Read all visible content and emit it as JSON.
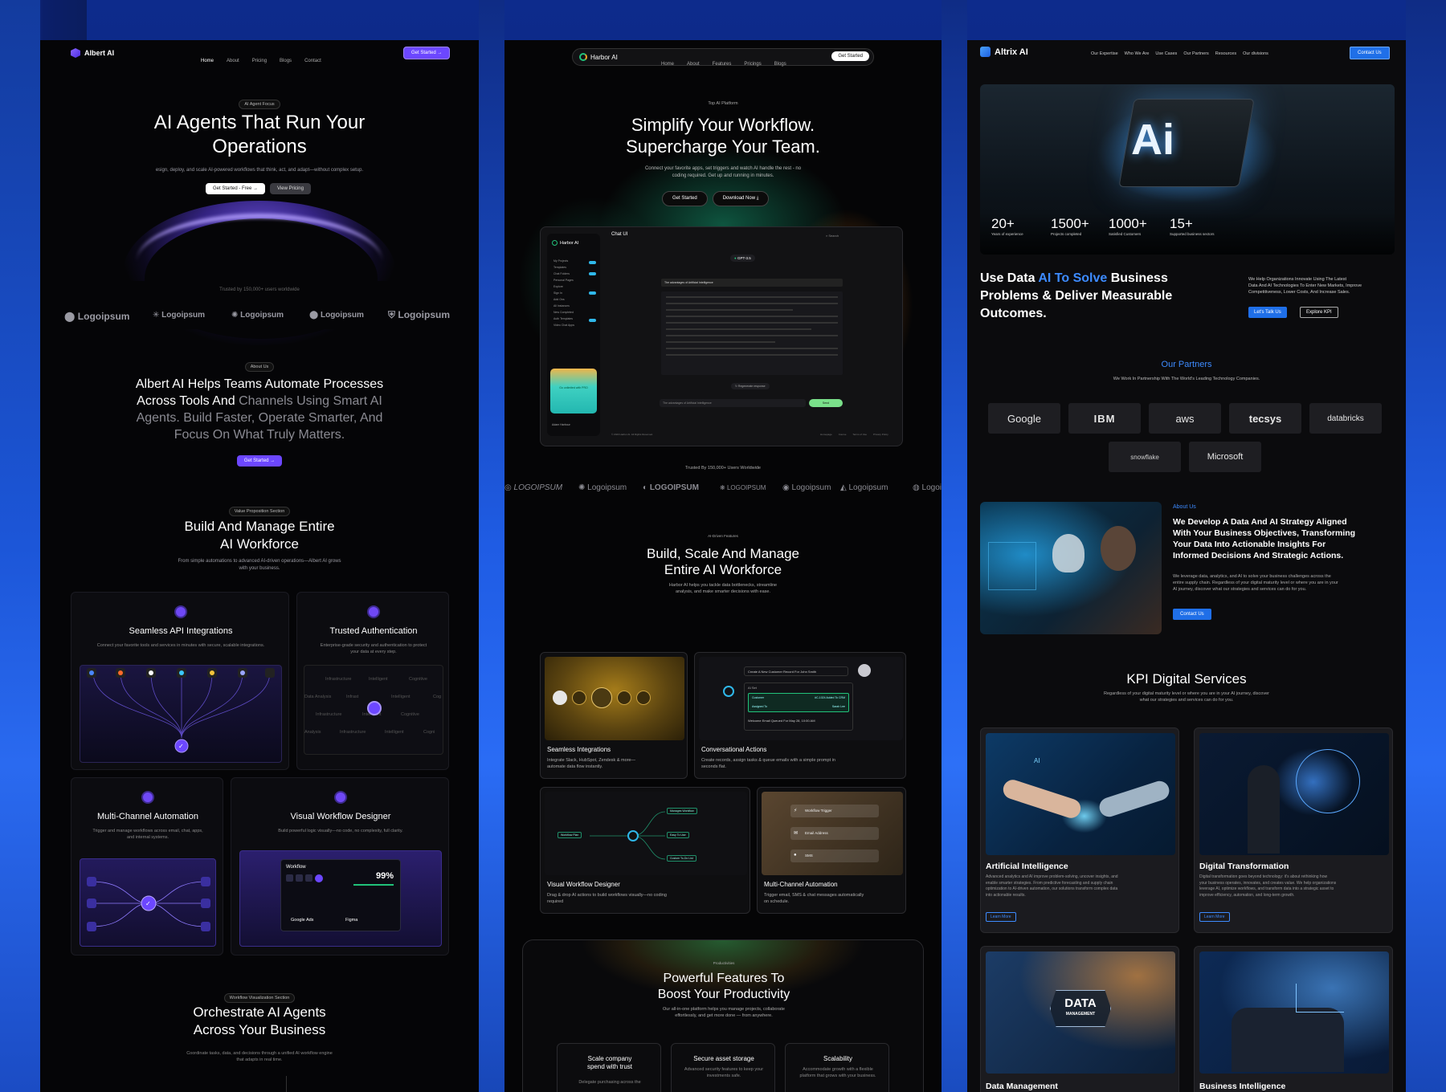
{
  "p1": {
    "brand": "Albert AI",
    "nav": [
      "Home",
      "About",
      "Pricing",
      "Blogs",
      "Contact"
    ],
    "cta": "Get Started",
    "pill": "AI Agent Focus",
    "hero": [
      "AI Agents That Run Your",
      "Operations"
    ],
    "hero_sub": "esign, deploy, and scale AI-powered workflows that think, act, and adapt—without complex setup.",
    "btn1": "Get Started - Free",
    "btn2": "View Pricing",
    "trusted": "Trusted by 150,000+ users worldwide",
    "logos": [
      "Logoipsum",
      "Logoipsum",
      "Logoipsum",
      "Logoipsum",
      "Logoipsum"
    ],
    "about_pill": "About Us",
    "about": [
      "Albert AI Helps Teams Automate Processes",
      "Across Tools And",
      "Channels Using Smart AI",
      "Agents. Build Faster, Operate Smarter, And",
      "Focus On What Truly Matters."
    ],
    "about_btn": "Get Started",
    "value_pill": "Value Proposition Section",
    "build": [
      "Build And Manage Entire",
      "AI Workforce"
    ],
    "build_sub": [
      "From simple automations to advanced AI-driven operations—Albert AI grows",
      "with your business."
    ],
    "f1": "Seamless API Integrations",
    "f1_sub": "Connect your favorite tools and services in minutes with secure, scalable integrations.",
    "f2": "Trusted Authentication",
    "f2_sub": [
      "Enterprise-grade security and authentication to protect",
      "your data at every step."
    ],
    "auth_words": [
      "Infrastructure",
      "Intelligent",
      "Cognitive",
      "Data Analysis",
      "Infrast",
      "Intelligent",
      "Cog",
      "Infrastructure",
      "Intelligent",
      "Cognitive",
      "Analysis",
      "Infrastructure",
      "Intelligent",
      "Cogni"
    ],
    "f3": "Multi-Channel Automation",
    "f3_sub": [
      "Trigger and manage workflows across email, chat, apps,",
      "and internal systems."
    ],
    "f4": "Visual Workflow Designer",
    "f4_sub": "Build powerful logic visually—no code, no complexity, full clarity.",
    "wf_label": "Workflow",
    "wf_pct": "99%",
    "wf_a": "Google Ads",
    "wf_b": "Figma",
    "orch_pill": "Workflow Visualization Section",
    "orch": [
      "Orchestrate AI Agents",
      "Across Your Business"
    ],
    "orch_sub": [
      "Coordinate tasks, data, and decisions through a unified AI workflow engine",
      "that adapts in real time."
    ]
  },
  "p2": {
    "brand": "Harbor AI",
    "nav": [
      "Home",
      "About",
      "Features",
      "Pricings",
      "Blogs"
    ],
    "cta": "Get Started",
    "pill": "Top AI Platform",
    "hero": [
      "Simplify Your Workflow.",
      "Supercharge Your Team."
    ],
    "hero_sub": [
      "Connect your favorite apps, set triggers and watch AI handle the rest - no",
      "coding required. Get up and running in minutes."
    ],
    "btn1": "Get Started",
    "btn2": "Download Now",
    "chat_title": "Chat UI",
    "chat_brand": "Harbor AI",
    "chat_search": "Search",
    "chat_model": "GPT-3.5",
    "chat_side": [
      "My Projects",
      "Templates",
      "Chat Folders",
      "Personal Pages",
      "Explore",
      "Sign In",
      "Add Ons",
      "All Instances",
      "New Completed",
      "Auth Templates",
      "Video Chat Apps"
    ],
    "chat_q": "The advantages of Artificial Intelligence",
    "chat_regen": "Regenerate response",
    "chat_input": "The advantages of Artificial Intelligence",
    "chat_send": "Send",
    "chat_promo": "Go unlimited with PRO",
    "chat_user": "Adam Harbour",
    "chat_footer": "© 2023 Harbor AI. All Rights Reserved.",
    "chat_footer_links": [
      "Homepage",
      "Course",
      "Terms of Use",
      "Privacy Policy"
    ],
    "trusted": "Trusted By 150,000+ Users Worldwide",
    "logos": [
      "LOGOIPSUM",
      "Logoipsum",
      "LOGOIPSUM",
      "LOGOIPSUM",
      "Logoipsum",
      "Logoipsum",
      "Logoi"
    ],
    "feat_pill": "AI-Driven Features",
    "build": [
      "Build, Scale And Manage",
      "Entire AI Workforce"
    ],
    "build_sub": [
      "Harbor AI helps you tackle data bottlenecks, streamline",
      "analysis, and make smarter decisions with ease."
    ],
    "c1": "Seamless Integrations",
    "c1_sub": [
      "Integrate Slack, HubSpot, Zendesk & more—",
      "automate data flow instantly."
    ],
    "c2": "Conversational Actions",
    "c2_sub": [
      "Create records, assign tasks & queue emails with a simple prompt in",
      "seconds flat."
    ],
    "c2_prompt": "Create A New Customer Record For John Smith",
    "c2_ai": "AI Set",
    "c2_r1": [
      "Customer",
      "#C-1024 Added To CRM"
    ],
    "c2_r2": [
      "Assigned To",
      "Sarah Lee"
    ],
    "c2_r3": "Welcome Email Queued For May 28, 10:00 AM",
    "c3": "Visual Workflow Designer",
    "c3_sub": [
      "Drag & drop AI actions to build workflows visually—no coding",
      "required"
    ],
    "c3_nodes": [
      "Workflow Plan",
      "Manages Workflow",
      "Easy To Use",
      "Custom To-Do List"
    ],
    "c4": "Multi-Channel Automation",
    "c4_sub": [
      "Trigger email, SMS & chat messages automatically",
      "on schedule."
    ],
    "c4_rows": [
      "Workflow Trigger",
      "Email Address",
      "SMS"
    ],
    "prod_pill": "Productivities",
    "prod": [
      "Powerful Features To",
      "Boost Your Productivity"
    ],
    "prod_sub": [
      "Our all-in-one platform helps you manage projects, collaborate",
      "effortlessly, and get more done — from anywhere."
    ],
    "pc1": [
      "Scale company",
      "spend with trust"
    ],
    "pc1_sub": "Delegate purchasing across the",
    "pc2": "Secure asset storage",
    "pc2_sub": [
      "Advanced security features to keep your",
      "investments safe."
    ],
    "pc3": "Scalability",
    "pc3_sub": [
      "Accommodate growth with a flexible",
      "platform that grows with your business."
    ]
  },
  "p3": {
    "brand": "Altrix AI",
    "nav": [
      "Our Expertise",
      "Who We Are",
      "Use Cases",
      "Our Partners",
      "Resources",
      "Our divisions"
    ],
    "cta": "Contact Us",
    "chip": "Ai",
    "stats": [
      {
        "v": "20+",
        "l": "Years of experience"
      },
      {
        "v": "1500+",
        "l": "Projects completed"
      },
      {
        "v": "1000+",
        "l": "Satisfied Customers"
      },
      {
        "v": "15+",
        "l": "Supported business sectors"
      }
    ],
    "hero_a": "Use Data ",
    "hero_b": "AI To Solve",
    "hero_c": " Business",
    "hero_2": "Problems & Deliver Measurable",
    "hero_3": "Outcomes.",
    "hero_sub": [
      "We Help Organizations Innovate Using The Latest",
      "Data And AI Technologies To Enter New Markets, Improve",
      "Competitiveness, Lower Costs, And Increase Sales."
    ],
    "btn1": "Let's Talk Us",
    "btn2": "Explore KPI",
    "partners_title": "Our Partners",
    "partners_sub": "We Work In Partnership With The World's Leading Technology Companies.",
    "partners": [
      "Google",
      "IBM",
      "aws",
      "tecsys",
      "databricks",
      "snowflake",
      "Microsoft"
    ],
    "about_pill": "About Us",
    "about": [
      "We Develop A Data And AI Strategy Aligned",
      "With Your Business Objectives, Transforming",
      "Your Data Into Actionable Insights For",
      "Informed Decisions And Strategic Actions."
    ],
    "about_sub": [
      "We leverage data, analytics, and AI to solve your business challenges across the",
      "entire supply chain. Regardless of your digital maturity level or where you are in your",
      "AI journey, discover what our strategies and services can do for you."
    ],
    "about_btn": "Contact Us",
    "kpi": "KPI Digital Services",
    "kpi_sub": [
      "Regardless of your digital maturity level or where you are in your AI journey, discover",
      "what our strategies and services can do for you."
    ],
    "s1": "Artificial Intelligence",
    "s1_sub": [
      "Advanced analytics and AI improve problem-solving, uncover insights, and",
      "enable smarter strategies. From predictive forecasting and supply chain",
      "optimization to AI-driven automation, our solutions transform complex data",
      "into actionable results."
    ],
    "s2": "Digital Transformation",
    "s2_sub": [
      "Digital transformation goes beyond technology: it's about rethinking how",
      "your business operates, innovates, and creates value. We help organizations",
      "leverage AI, optimize workflows, and transform data into a strategic asset to",
      "improve efficiency, automation, and long-term growth."
    ],
    "learn": "Learn More",
    "s3": "Data Management",
    "s3_badge": "DATA",
    "s3_badge2": "MANAGEMENT",
    "s4": "Business Intelligence"
  },
  "colors": {
    "purple": "#6c47ff",
    "blue": "#2f7bf6",
    "green": "#21c27a",
    "cyan": "#2fb8ea"
  }
}
